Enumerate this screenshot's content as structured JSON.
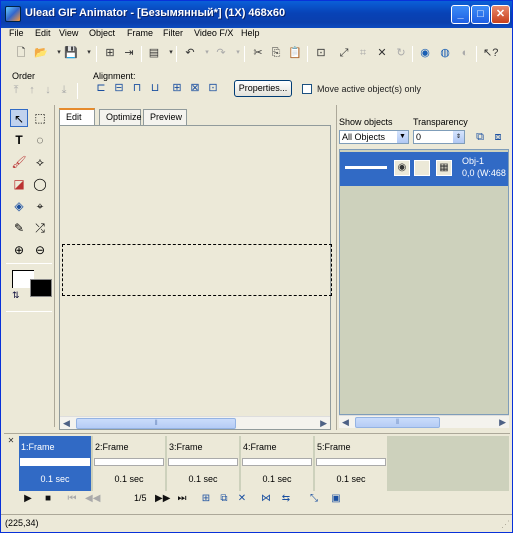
{
  "window": {
    "title": "Ulead GIF Animator - [Безымянный*] (1X) 468x60"
  },
  "menu": [
    "File",
    "Edit",
    "View",
    "Object",
    "Frame",
    "Filter",
    "Video F/X",
    "Help"
  ],
  "toolbar": {
    "order_label": "Order",
    "alignment_label": "Alignment:",
    "properties_button": "Properties...",
    "move_active_label": "Move active object(s) only"
  },
  "edit": {
    "tabs": [
      "Edit",
      "Optimize",
      "Preview"
    ]
  },
  "objects_panel": {
    "show_objects_label": "Show objects",
    "transparency_label": "Transparency",
    "show_objects_value": "All Objects",
    "transparency_value": "0",
    "object_name": "Obj-1",
    "object_pos": "0,0 (W:468"
  },
  "frames": [
    {
      "name": "1:Frame",
      "delay": "0.1 sec"
    },
    {
      "name": "2:Frame",
      "delay": "0.1 sec"
    },
    {
      "name": "3:Frame",
      "delay": "0.1 sec"
    },
    {
      "name": "4:Frame",
      "delay": "0.1 sec"
    },
    {
      "name": "5:Frame",
      "delay": "0.1 sec"
    }
  ],
  "playback": {
    "counter": "1/5"
  },
  "status": {
    "coords": "(225,34)"
  }
}
